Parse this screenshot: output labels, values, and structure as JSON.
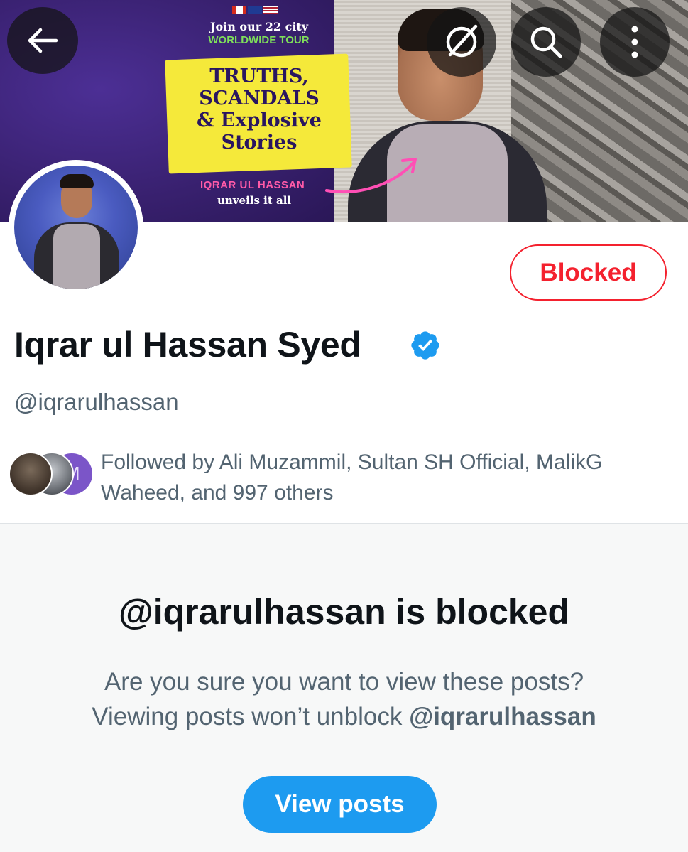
{
  "banner": {
    "tour_line1": "Join our 22 city",
    "tour_line2": "WORLDWIDE TOUR",
    "headline_1": "TRUTHS,",
    "headline_2": "SCANDALS",
    "headline_3": "& Explosive",
    "headline_4": "Stories",
    "name_line": "IQRAR UL HASSAN",
    "tagline": "unveils it all"
  },
  "toolbar": {
    "back_icon": "arrow-left-icon",
    "grok_icon": "grok-icon",
    "search_icon": "search-icon",
    "more_icon": "more-vertical-icon"
  },
  "profile": {
    "display_name": "Iqrar ul Hassan Syed",
    "handle": "@iqrarulhassan",
    "verified_color": "#1d9bf0",
    "blocked_label": "Blocked",
    "followed_by": "Followed by Ali Muzammil, Sultan SH Official, MalikG Waheed, and 997 others",
    "follower_avatar_initial": "M"
  },
  "blocked_panel": {
    "title": "@iqrarulhassan is blocked",
    "message_1": "Are you sure you want to view these posts?",
    "message_2_prefix": "Viewing posts won’t unblock ",
    "message_2_handle": "@iqrarulhassan",
    "button_label": "View posts"
  },
  "colors": {
    "accent": "#1d9bf0",
    "danger": "#f4212e",
    "muted_text": "#536471"
  }
}
